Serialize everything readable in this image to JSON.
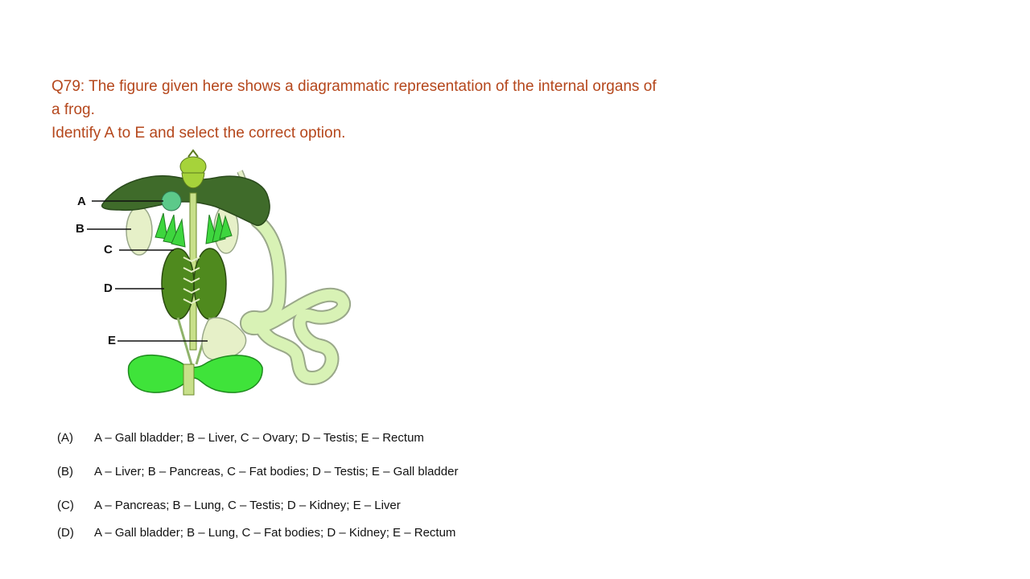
{
  "question": {
    "line1": "Q79: The figure given here shows a diagrammatic representation of the internal organs of",
    "line2": "a frog.",
    "line3": "Identify A to E and select the correct option."
  },
  "figure": {
    "labels": [
      "A",
      "B",
      "C",
      "D",
      "E"
    ]
  },
  "options": [
    {
      "key": "(A)",
      "text": "A – Gall bladder; B – Liver, C – Ovary; D – Testis; E – Rectum"
    },
    {
      "key": "(B)",
      "text": "A – Liver; B – Pancreas, C – Fat bodies; D – Testis; E – Gall bladder"
    },
    {
      "key": "(C)",
      "text": "A – Pancreas; B – Lung, C – Testis; D – Kidney; E – Liver"
    },
    {
      "key": "(D)",
      "text": "A – Gall bladder; B – Lung, C – Fat bodies; D – Kidney; E – Rectum"
    }
  ],
  "colors": {
    "question_text": "#b5471c",
    "liver": "#3f6b2a",
    "kidney": "#4f8a1e",
    "bladder": "#3fe33a",
    "intestine": "#d8f2b5",
    "lung": "#e6f0c8"
  }
}
